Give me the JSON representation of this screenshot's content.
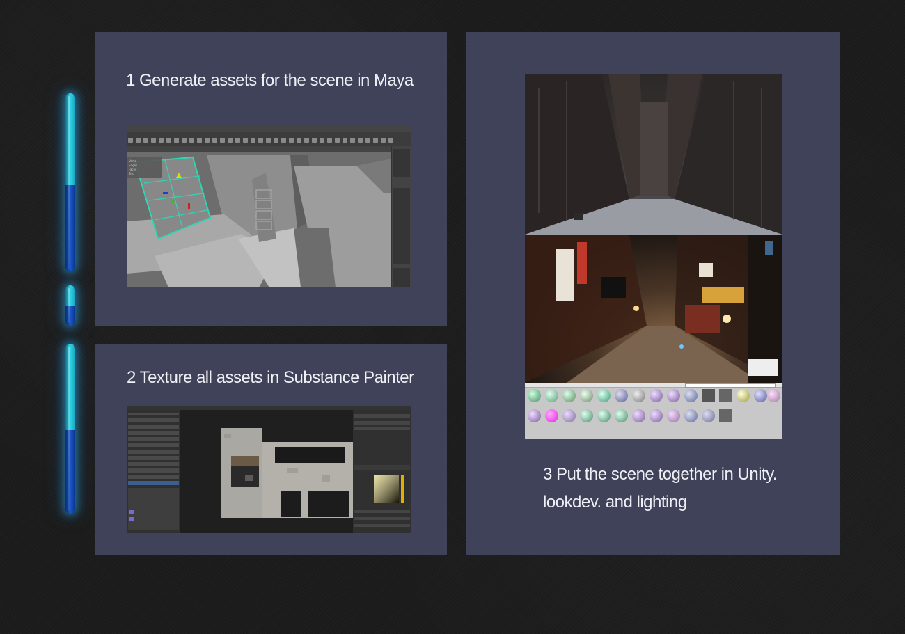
{
  "progress": {
    "tubes": [
      {
        "label": "tube-1",
        "fill": 0.5
      },
      {
        "label": "tube-2",
        "fill": 0.5
      },
      {
        "label": "tube-3",
        "fill": 0.5
      }
    ],
    "colors": {
      "upper": "#2fd6e6",
      "lower": "#1b58c6",
      "glow": "#28aae6"
    }
  },
  "steps": {
    "maya": {
      "title": "1 Generate assets for the scene in Maya"
    },
    "substance": {
      "title": "2 Texture all assets in Substance Painter"
    },
    "unity": {
      "title_line1": "3 Put the scene together in Unity.",
      "title_line2": "lookdev. and lighting"
    }
  },
  "colors": {
    "background": "#1c1c1c",
    "panel": "#40425a",
    "text": "#eef0f6"
  },
  "screenshots": {
    "maya": {
      "app": "Maya viewport"
    },
    "substance": {
      "app": "Substance Painter"
    },
    "unity": {
      "app": "Unity editor"
    }
  }
}
